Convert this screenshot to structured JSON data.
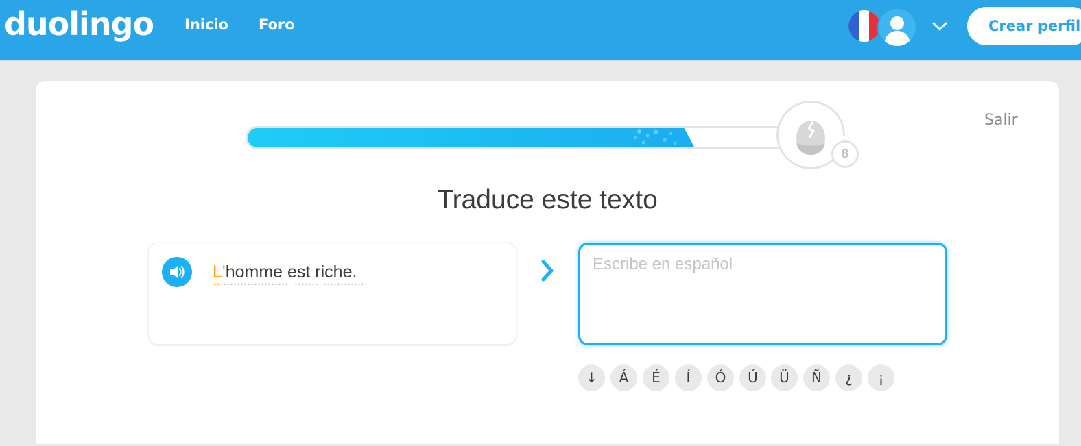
{
  "header": {
    "logo_text": "duolingo",
    "nav": [
      {
        "label": "Inicio"
      },
      {
        "label": "Foro"
      }
    ],
    "create_profile_label": "Crear perfil",
    "brand_color": "#2aa6e8"
  },
  "lesson": {
    "exit_label": "Salir",
    "progress": 0.82,
    "egg_count": "8",
    "title": "Traduce este texto",
    "prompt_prefix": "L'",
    "prompt_rest": "homme est riche.",
    "answer_placeholder": "Escribe en español",
    "answer_value": "",
    "special_chars": [
      "↓",
      "Á",
      "É",
      "Í",
      "Ó",
      "Ú",
      "Ü",
      "Ñ",
      "¿",
      "¡"
    ]
  },
  "icons": [
    "speaker-icon",
    "chevron-down-icon",
    "arrow-right-icon",
    "egg-icon",
    "flag-french-icon",
    "avatar-icon"
  ]
}
